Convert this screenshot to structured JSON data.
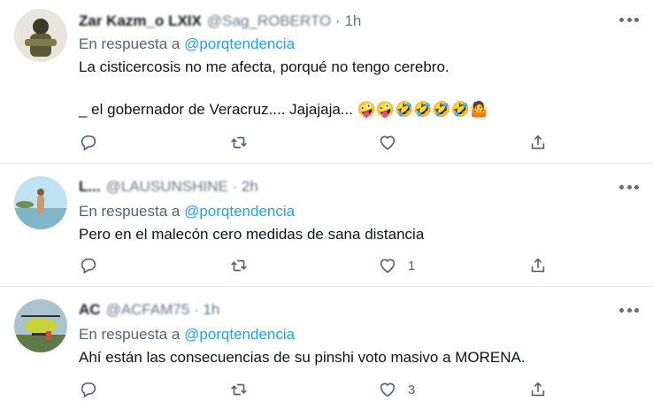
{
  "tweets": [
    {
      "name": "Zar Kazm_o LXIX",
      "handle": "@Sag_ROBERTO",
      "separator": "·",
      "time": "1h",
      "reply_prefix": "En respuesta a",
      "reply_to": "@porqtendencia",
      "text_lines": [
        "La cisticercosis no me afecta, porqué no tengo cerebro.",
        "_ el gobernador de Veracruz.... Jajajaja... 🤪🤪🤣🤣🤣🤣🤷"
      ],
      "likes": "",
      "avatar_colors": [
        "#9aa07a",
        "#3b3a24"
      ]
    },
    {
      "name": "L...",
      "handle": "@LAUSUNSHINE",
      "separator": "·",
      "time": "2h",
      "reply_prefix": "En respuesta a",
      "reply_to": "@porqtendencia",
      "text_lines": [
        "Pero en el malecón cero medidas de sana distancia"
      ],
      "likes": "1",
      "avatar_colors": [
        "#8bc7e0",
        "#c99a72"
      ]
    },
    {
      "name": "AC",
      "handle": "@ACFAM75",
      "separator": "·",
      "time": "1h",
      "reply_prefix": "En respuesta a",
      "reply_to": "@porqtendencia",
      "text_lines": [
        "Ahí están las consecuencias de su pinshi voto masivo a MORENA."
      ],
      "likes": "3",
      "avatar_colors": [
        "#c8d33a",
        "#4a6f8a"
      ]
    }
  ],
  "icons": {
    "reply": "reply-icon",
    "retweet": "retweet-icon",
    "like": "like-icon",
    "share": "share-icon",
    "more": "more-icon"
  },
  "colors": {
    "link": "#1da1f2",
    "muted": "#536471",
    "divider": "#e6ecf0"
  }
}
